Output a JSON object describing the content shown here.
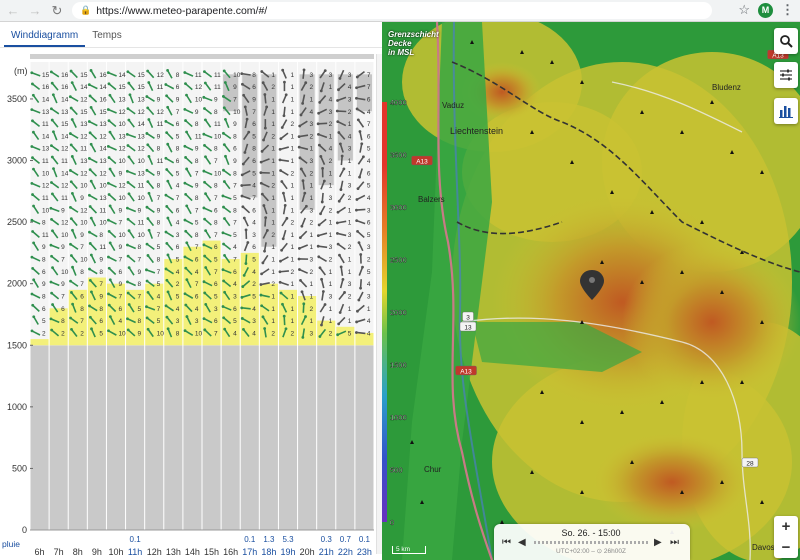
{
  "browser": {
    "url": "https://www.meteo-parapente.com/#/",
    "profile_initial": "M"
  },
  "tabs": [
    {
      "label": "Winddiagramm",
      "active": true
    },
    {
      "label": "Temps",
      "active": false
    }
  ],
  "diagram": {
    "unit_label": "(m)",
    "y_ticks": [
      0,
      500,
      1000,
      1500,
      2000,
      2500,
      3000,
      3500
    ],
    "y_max": 3800,
    "ground_level": 1500,
    "hours": [
      "6h",
      "7h",
      "8h",
      "9h",
      "10h",
      "11h",
      "12h",
      "13h",
      "14h",
      "15h",
      "16h",
      "17h",
      "18h",
      "19h",
      "20h",
      "21h",
      "22h",
      "23h"
    ],
    "rain_label": "pluie",
    "rain": [
      "",
      "",
      "",
      "",
      "",
      "0.1",
      "",
      "",
      "",
      "",
      "",
      "0.1",
      "1.3",
      "5.3",
      "",
      "0.3",
      "0.7",
      "0.1"
    ],
    "thermal_top": [
      1550,
      1800,
      1950,
      2050,
      2000,
      1950,
      2000,
      2200,
      2300,
      2350,
      2200,
      2250,
      2000,
      1950,
      1900,
      1700,
      1650,
      1600
    ],
    "cloud_columns": [
      10,
      11,
      12,
      14,
      15,
      16,
      17
    ],
    "speed_top_row": [
      15,
      16,
      15,
      16,
      14,
      15,
      12,
      8,
      11,
      11,
      10,
      8,
      1,
      1,
      3,
      3,
      3,
      7
    ],
    "speed_bottom_row": [
      2,
      2,
      2,
      5,
      10,
      9,
      10,
      8,
      10,
      7,
      4,
      4,
      2,
      2,
      3,
      2,
      5,
      4
    ]
  },
  "map": {
    "title_lines": [
      "Grenzschicht",
      "Decke",
      "in MSL"
    ],
    "legend_values": [
      "4000",
      "3500",
      "3000",
      "2500",
      "2000",
      "1500",
      "1000",
      "500",
      "0"
    ],
    "places": [
      "Vaduz",
      "Liechtenstein",
      "Bludenz",
      "Balzers",
      "Chur",
      "Davos"
    ],
    "road_labels": [
      "A13",
      "A13",
      "A13",
      "3",
      "13",
      "28"
    ],
    "time_label": "So. 26. - 15:00",
    "time_sub": "UTC+02:00 – ⊙ 26h00Z",
    "scale_label": "5 km",
    "colors": {
      "low": "#2d9a3a",
      "mid": "#c9c232",
      "high": "#c46a1c",
      "accent": "#1a4fa0"
    }
  }
}
